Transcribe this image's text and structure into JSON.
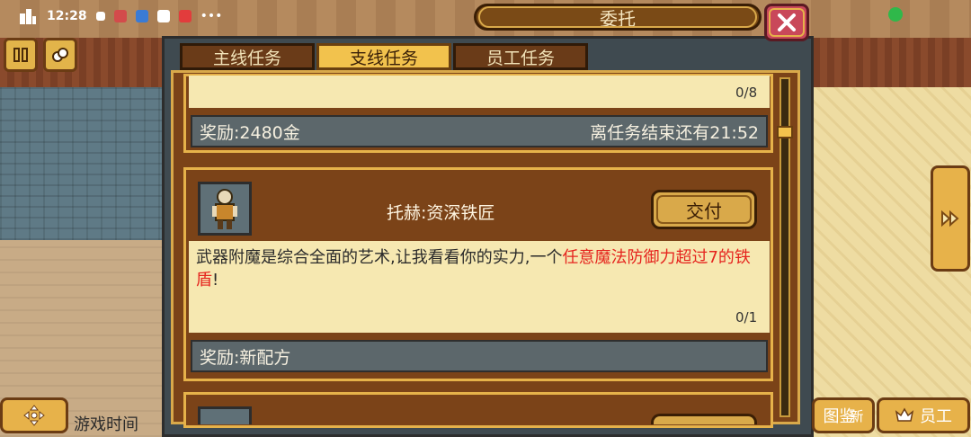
{
  "status_bar": {
    "time": "12:28",
    "more_icon": "more-dots-icon"
  },
  "dialog": {
    "title": "委托",
    "close_icon": "close-icon"
  },
  "tabs": [
    {
      "label": "主线任务",
      "active": false
    },
    {
      "label": "支线任务",
      "active": true
    },
    {
      "label": "员工任务",
      "active": false
    }
  ],
  "quest_prev": {
    "progress": "0/8",
    "reward": "奖励:2480金",
    "time_left": "离任务结束还有21:52"
  },
  "quest_current": {
    "npc": "托赫:资深铁匠",
    "deliver_label": "交付",
    "desc_plain": "武器附魔是综合全面的艺术,让我看看你的实力,一个",
    "desc_highlight": "任意魔法防御力超过7的铁盾",
    "desc_end": "!",
    "progress": "0/1",
    "reward": "奖励:新配方"
  },
  "bottom": {
    "game_time": "游戏时间",
    "catalog_label": "图鉴",
    "catalog_badge": "新",
    "staff_label": "员工"
  },
  "colors": {
    "highlight": "#e5241e",
    "gold": "#f2c24d"
  }
}
